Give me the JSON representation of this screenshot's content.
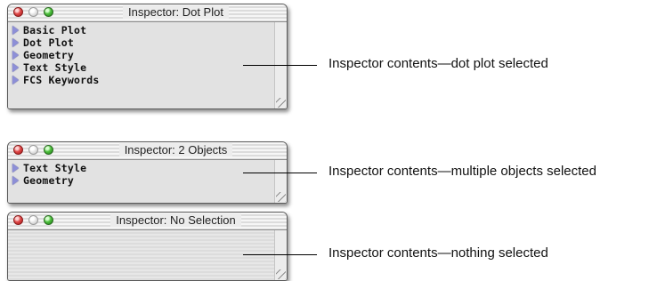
{
  "windows": [
    {
      "title": "Inspector: Dot Plot",
      "items": [
        "Basic Plot",
        "Dot Plot",
        "Geometry",
        "Text Style",
        "FCS Keywords"
      ]
    },
    {
      "title": "Inspector: 2 Objects",
      "items": [
        "Text Style",
        "Geometry"
      ]
    },
    {
      "title": "Inspector: No Selection",
      "items": []
    }
  ],
  "captions": [
    "Inspector contents—dot plot selected",
    "Inspector contents—multiple objects selected",
    "Inspector contents—nothing selected"
  ],
  "colors": {
    "close": "#e04a4a",
    "minimize": "#dedede",
    "zoom": "#4fc13f",
    "disclosure_triangle": "#8d8fd7"
  }
}
